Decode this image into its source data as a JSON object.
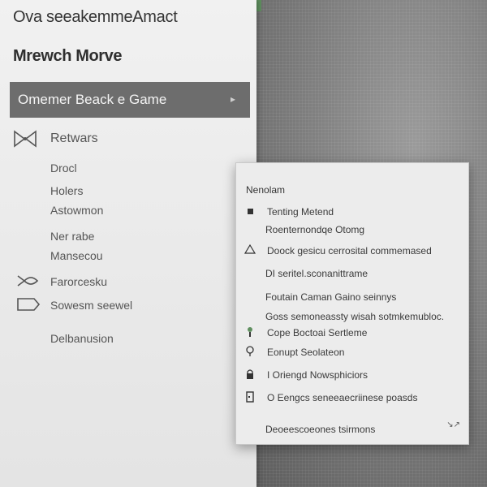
{
  "window": {
    "title": "Ova seeakemmeAmact"
  },
  "sidebar": {
    "section_title": "Mrewch Morve",
    "selected_item": {
      "label": "Omemer Beack e Game",
      "chevron_icon": "chevron-right-icon"
    },
    "items": [
      {
        "label": "Retwars",
        "icon": "bowtie-icon"
      },
      {
        "label": "Drocl",
        "icon": ""
      },
      {
        "label": "Holers",
        "icon": ""
      },
      {
        "label": "Astowmon",
        "icon": ""
      },
      {
        "label": "Ner rabe",
        "icon": ""
      },
      {
        "label": "Mansecou",
        "icon": ""
      },
      {
        "label": "Farorcesku",
        "icon": "fish-icon"
      },
      {
        "label": "Sowesm seewel",
        "icon": "tag-icon"
      },
      {
        "label": "Delbanusion",
        "icon": ""
      }
    ]
  },
  "menu": {
    "header": "Nenolam",
    "items": [
      {
        "label": "Tenting Metend",
        "icon": "square-icon"
      },
      {
        "label": "Roenternondqe Otomg",
        "icon": ""
      },
      {
        "label": "Doock gesicu cerrosital commemased",
        "icon": "warning-triangle-icon"
      },
      {
        "label": "DI seritel.sconanittrame",
        "icon": ""
      },
      {
        "label": "Foutain Caman Gaino seinnys",
        "icon": ""
      },
      {
        "label": "Goss semoneassty wisah sotmkemubloc.",
        "icon": ""
      },
      {
        "label": "Cope Boctoai Sertleme",
        "icon": "pin-icon"
      },
      {
        "label": "Eonupt Seolateon",
        "icon": "location-pin-icon"
      },
      {
        "label": "I Oriengd Nowsphiciors",
        "icon": "lock-icon"
      },
      {
        "label": "O Eengcs seneeaecriinese poasds",
        "icon": "door-icon"
      },
      {
        "label": "Deoeescoeones tsirmons",
        "icon": ""
      }
    ],
    "corner_glyph": "↘↗"
  },
  "colors": {
    "selected_row": "#6d6d6d",
    "sidebar_bg": "#efefef",
    "menu_bg": "#ececec",
    "accent": "#5f8f5f"
  }
}
